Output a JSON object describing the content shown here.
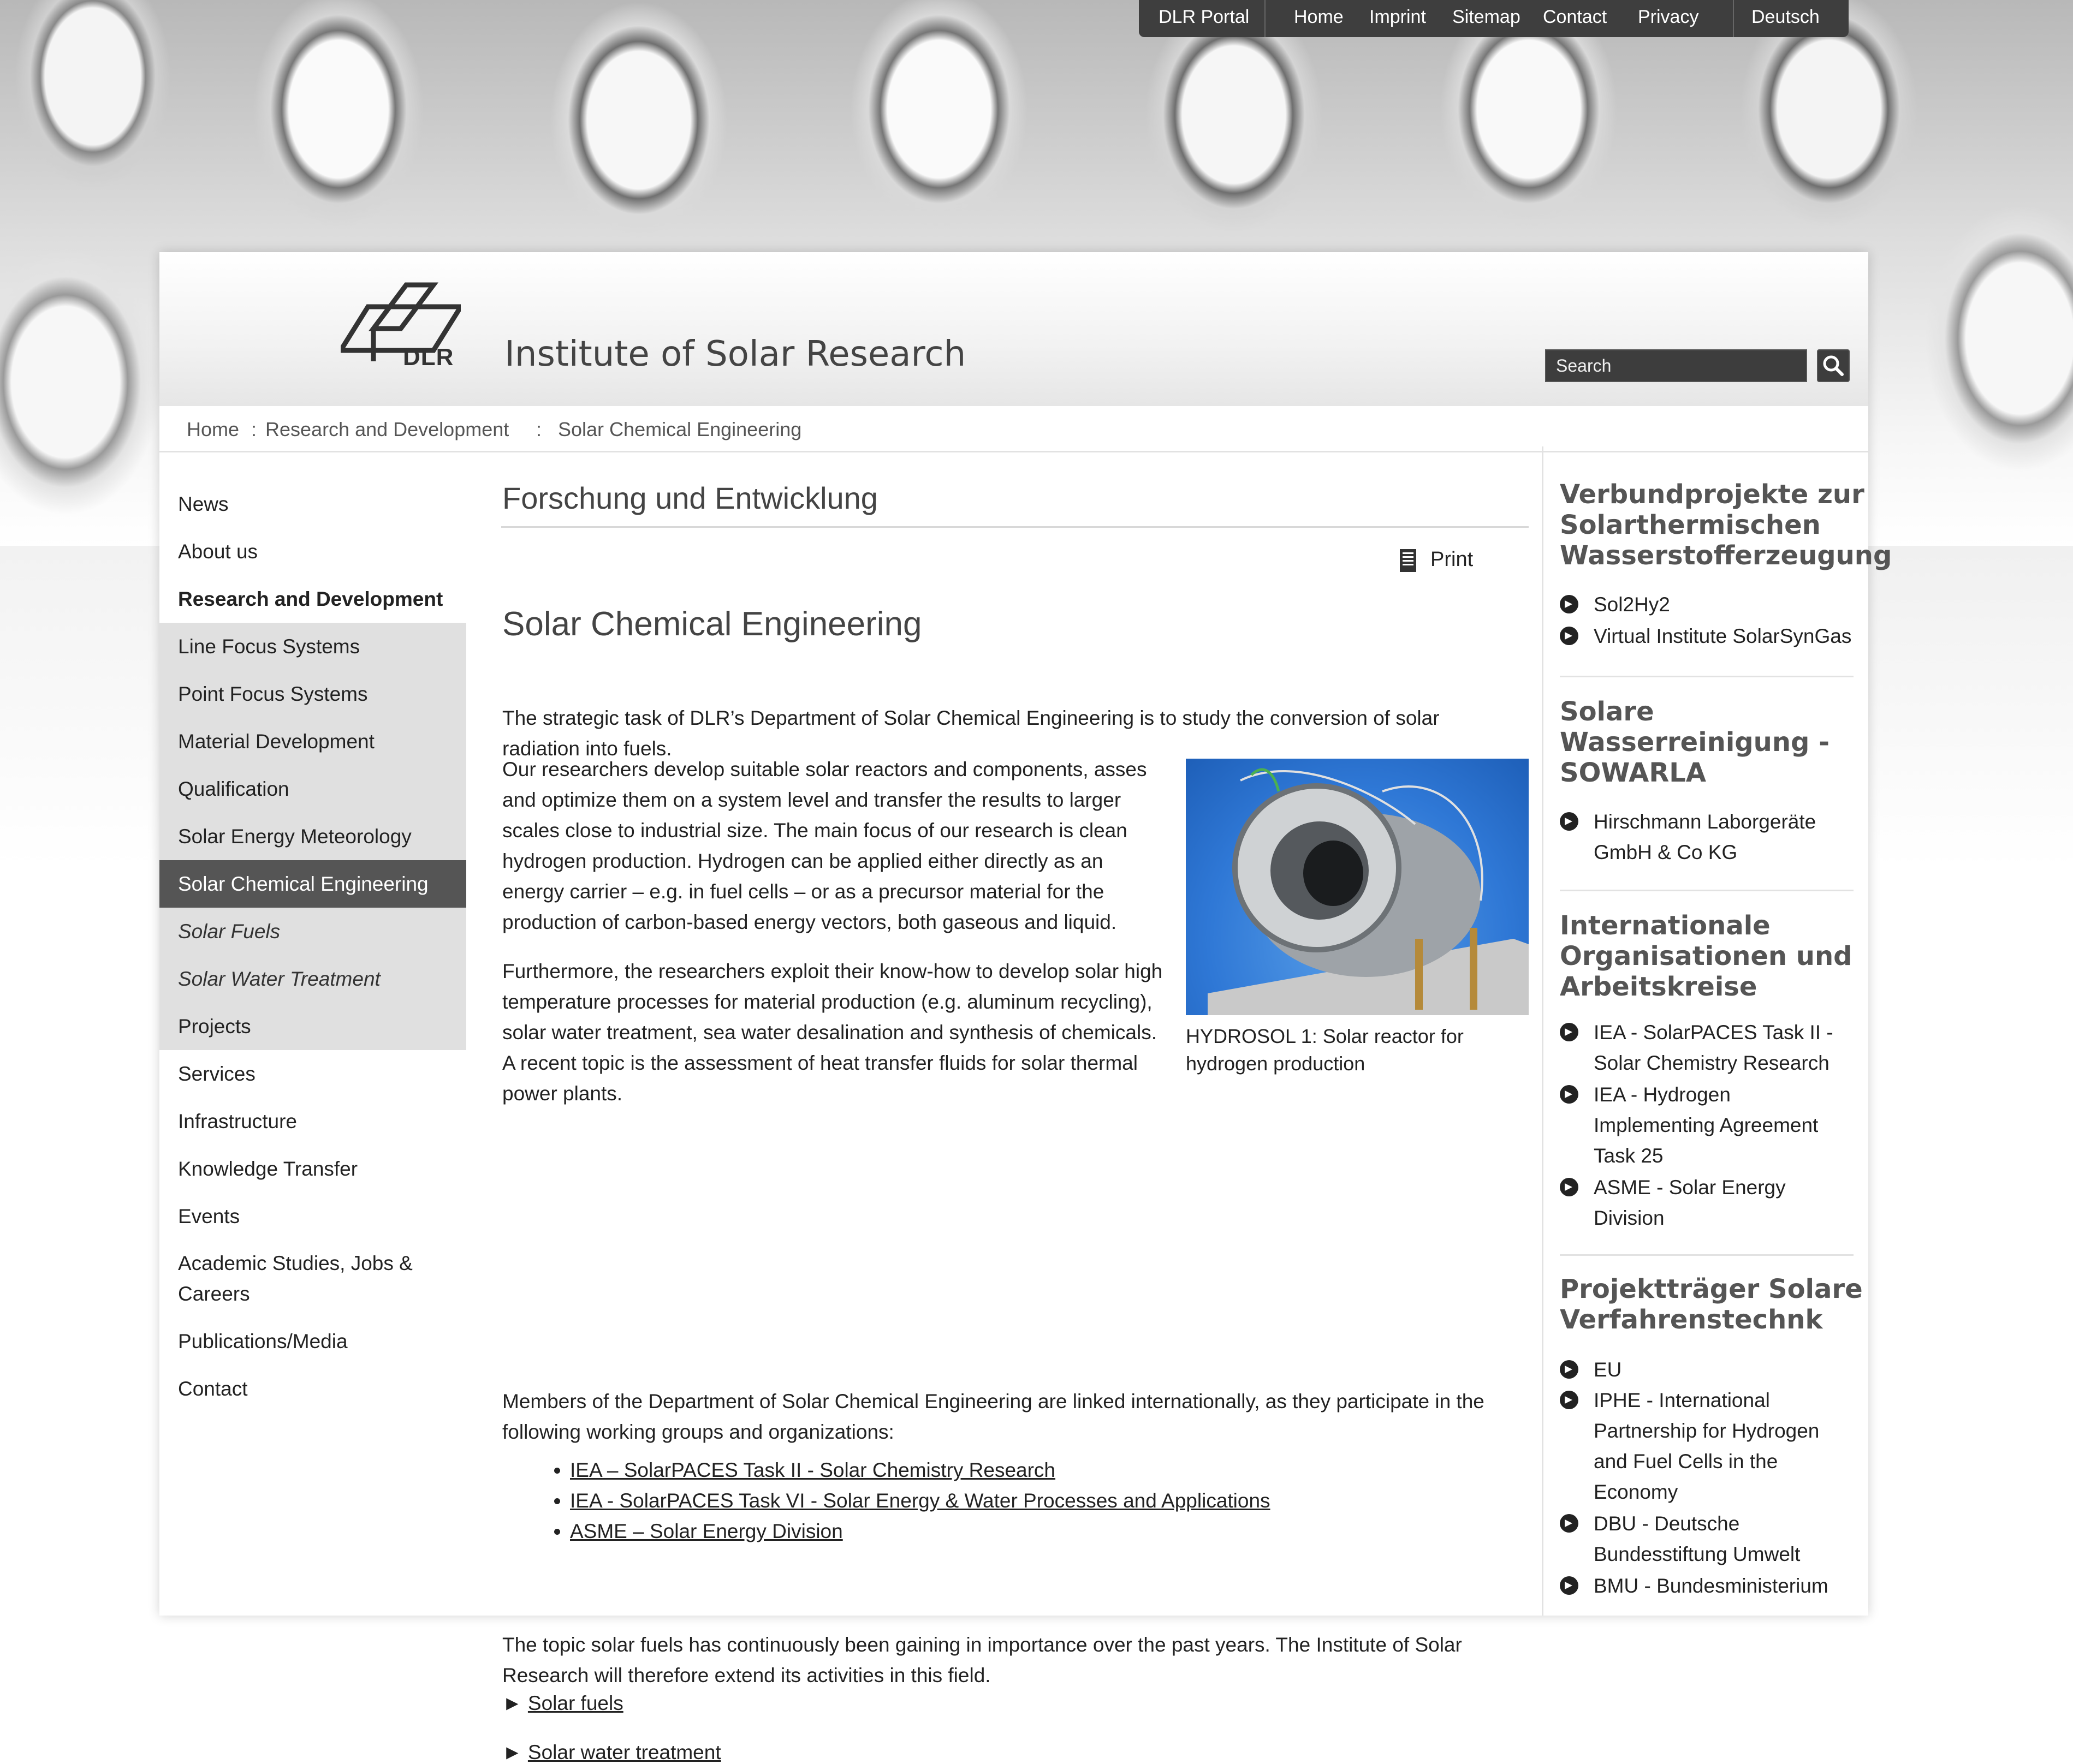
{
  "top_nav": {
    "portal": "DLR Portal",
    "home": "Home",
    "imprint": "Imprint",
    "sitemap": "Sitemap",
    "contact": "Contact",
    "privacy": "Privacy",
    "language": "Deutsch"
  },
  "header": {
    "logo_text": "DLR",
    "title": "Institute of Solar Research",
    "search_placeholder": "Search"
  },
  "breadcrumb": [
    "Home",
    ":",
    "Research and Development",
    ":",
    "Solar Chemical Engineering"
  ],
  "left_nav": [
    {
      "label": "News",
      "state": "normal"
    },
    {
      "label": "About us",
      "state": "normal"
    },
    {
      "label": "Research and Development",
      "state": "bold"
    },
    {
      "label": "Line Focus Systems",
      "state": "grey"
    },
    {
      "label": "Point Focus Systems",
      "state": "grey"
    },
    {
      "label": "Material Development",
      "state": "grey"
    },
    {
      "label": "Qualification",
      "state": "grey"
    },
    {
      "label": "Solar Energy Meteorology",
      "state": "grey"
    },
    {
      "label": "Solar Chemical Engineering",
      "state": "active"
    },
    {
      "label": "Solar Fuels",
      "state": "sub"
    },
    {
      "label": "Solar Water Treatment",
      "state": "sub"
    },
    {
      "label": "Projects",
      "state": "grey"
    },
    {
      "label": "Services",
      "state": "normal"
    },
    {
      "label": "Infrastructure",
      "state": "normal"
    },
    {
      "label": "Knowledge Transfer",
      "state": "normal"
    },
    {
      "label": "Events",
      "state": "normal"
    },
    {
      "label": "Academic Studies, Jobs & Careers",
      "state": "twoline"
    },
    {
      "label": "Publications/Media",
      "state": "normal"
    },
    {
      "label": "Contact",
      "state": "normal"
    }
  ],
  "content": {
    "section_title": "Forschung und Entwicklung",
    "print_label": "Print",
    "heading": "Solar Chemical Engineering",
    "intro": "The strategic task of DLR’s Department of Solar Chemical Engineering is to study the conversion of solar radiation into fuels.",
    "para1": "Our researchers develop suitable solar reactors and components, asses and optimize them on a system level and transfer the results to larger scales close to industrial size. The main focus of our research is clean hydrogen production. Hydrogen can be applied either directly as an energy carrier – e.g. in fuel cells – or as a precursor material for the production of carbon-based energy vectors, both gaseous and liquid.",
    "para2": "Furthermore, the researchers exploit their know-how to develop solar high temperature processes for material production (e.g. aluminum recycling), solar water treatment, sea water desalination and synthesis of chemicals. A recent topic is the assessment of heat transfer fluids for solar thermal power plants.",
    "figure_caption": "HYDROSOL 1: Solar reactor for hydrogen production",
    "para3": "Members of the Department of Solar Chemical Engineering are linked internationally, as they participate in the following working groups and organizations:",
    "links": [
      "IEA – SolarPACES Task II - Solar Chemistry Research",
      "IEA - SolarPACES Task VI - Solar Energy & Water Processes and Applications",
      "ASME – Solar Energy Division"
    ],
    "para4": "The topic solar fuels has continuously been gaining in importance over the past years. The Institute of Solar Research will therefore extend its activities in this field.",
    "arrow_symbol": "►",
    "arrow_links": [
      "Solar fuels",
      "Solar water treatment"
    ]
  },
  "right_col": [
    {
      "heading": "Verbundprojekte zur Solarthermischen Wasserstofferzeugung",
      "items": [
        "Sol2Hy2",
        "Virtual Institute SolarSynGas"
      ]
    },
    {
      "heading": "Solare Wasserreinigung - SOWARLA",
      "items": [
        "Hirschmann Laborgeräte GmbH & Co KG"
      ]
    },
    {
      "heading": "Internationale Organisationen und Arbeitskreise",
      "items": [
        "IEA - SolarPACES Task II - Solar Chemistry Research",
        "IEA - Hydrogen Implementing Agreement Task 25",
        "ASME - Solar Energy Division"
      ]
    },
    {
      "heading": "Projektträger Solare Verfahrenstechnk",
      "items": [
        "EU",
        "IPHE - International Partnership for Hydrogen and Fuel Cells in the Economy",
        "DBU - Deutsche Bundesstiftung Umwelt",
        "BMU - Bundesministerium"
      ]
    }
  ]
}
